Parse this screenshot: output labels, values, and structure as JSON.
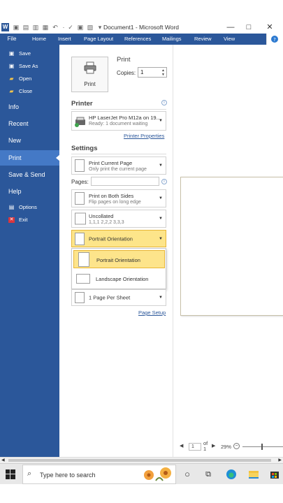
{
  "window": {
    "title": "Document1  -  Microsoft Word",
    "minimize_glyph": "—",
    "maximize_glyph": "□",
    "close_glyph": "✕"
  },
  "ribbon": {
    "file_tab": "File",
    "tabs": [
      "Home",
      "Insert",
      "Page Layout",
      "References",
      "Mailings",
      "Review",
      "View"
    ]
  },
  "sidebar": {
    "top_items": [
      {
        "label": "Save",
        "icon": "save-icon"
      },
      {
        "label": "Save As",
        "icon": "save-as-icon"
      },
      {
        "label": "Open",
        "icon": "open-folder-icon"
      },
      {
        "label": "Close",
        "icon": "close-folder-icon"
      }
    ],
    "big_items": [
      "Info",
      "Recent",
      "New",
      "Print",
      "Save & Send",
      "Help"
    ],
    "active_item": "Print",
    "bottom_items": [
      {
        "label": "Options",
        "icon": "options-icon"
      },
      {
        "label": "Exit",
        "icon": "exit-icon"
      }
    ]
  },
  "print": {
    "heading": "Print",
    "button_label": "Print",
    "copies_label": "Copies:",
    "copies_value": "1"
  },
  "printer": {
    "heading": "Printer",
    "name": "HP LaserJet Pro M12a on 19...",
    "status": "Ready: 1 document waiting",
    "properties_link": "Printer Properties"
  },
  "settings": {
    "heading": "Settings",
    "print_range_title": "Print Current Page",
    "print_range_sub": "Only print the current page",
    "pages_label": "Pages:",
    "pages_value": "",
    "sides_title": "Print on Both Sides",
    "sides_sub": "Flip pages on long edge",
    "collate_title": "Uncollated",
    "collate_sub": "1,1,1    2,2,2    3,3,3",
    "orientation_selected": "Portrait Orientation",
    "orientation_options": [
      "Portrait Orientation",
      "Landscape Orientation"
    ],
    "pages_per_sheet": "1 Page Per Sheet",
    "page_setup_link": "Page Setup"
  },
  "preview": {
    "current_page": "1",
    "of_label": "of",
    "total_pages": "1",
    "zoom": "29%"
  },
  "taskbar": {
    "search_placeholder": "Type here to search"
  },
  "colors": {
    "accent": "#2b579a",
    "highlight": "#fde48b"
  }
}
